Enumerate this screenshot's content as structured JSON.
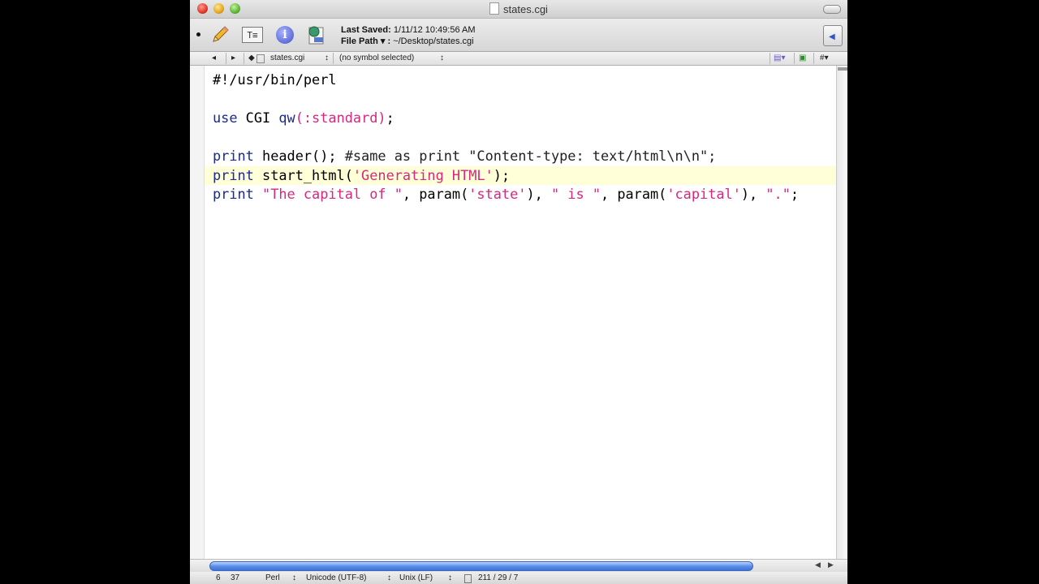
{
  "window": {
    "title": "states.cgi"
  },
  "toolbar": {
    "last_saved_label": "Last Saved:",
    "last_saved_value": "1/11/12 10:49:56 AM",
    "file_path_label": "File Path ▾ :",
    "file_path_value": "~/Desktop/states.cgi",
    "icons": [
      "pencil-icon",
      "text-options-icon",
      "info-icon",
      "script-icon",
      "sidebar-toggle-icon"
    ]
  },
  "navbar": {
    "back": "◂",
    "forward": "▸",
    "file_name": "states.cgi",
    "symbol": "(no symbol selected)",
    "hash": "#"
  },
  "code": {
    "highlighted_line": 6
  },
  "status": {
    "line": "6",
    "column": "37",
    "language": "Perl",
    "encoding": "Unicode (UTF-8)",
    "line_endings": "Unix (LF)",
    "counts": "211 / 29 / 7"
  },
  "colors": {
    "keyword": "#1c2a8a",
    "string": "#d6287f",
    "line_highlight": "#ffffd8",
    "scroll_thumb": "#5b8fea"
  }
}
